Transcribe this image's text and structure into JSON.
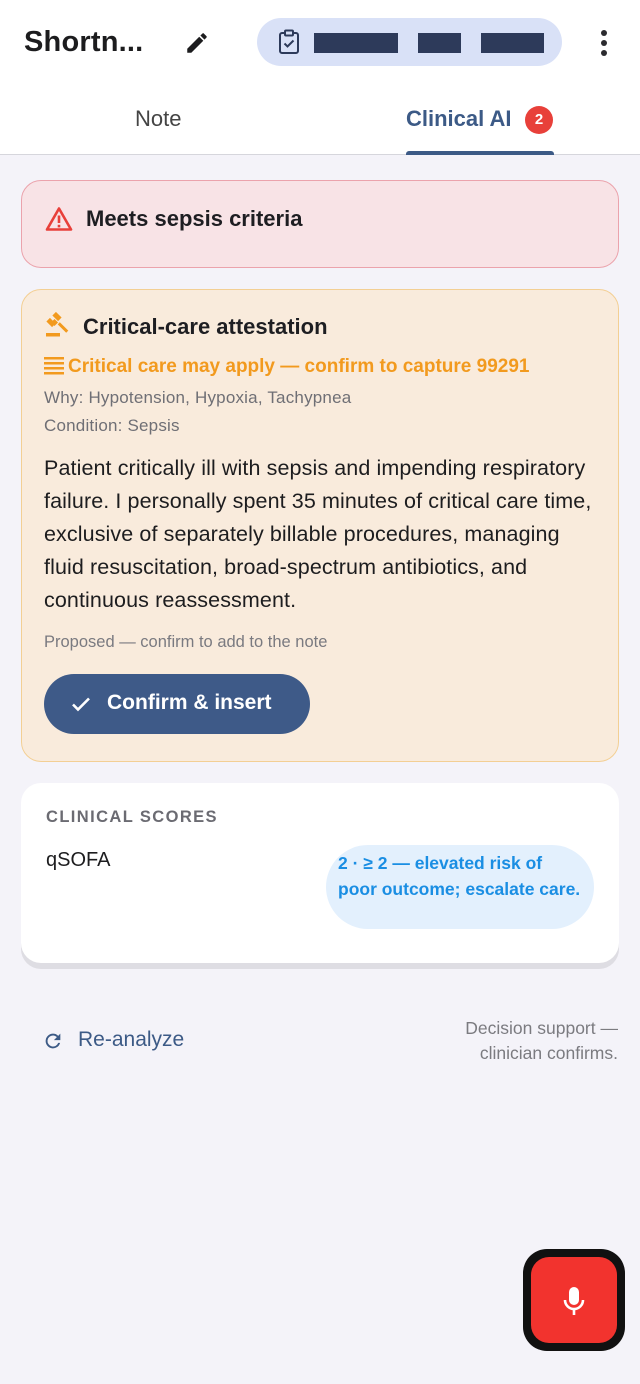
{
  "header": {
    "title": "Shortn...",
    "edit_icon": "pencil-icon",
    "patient_chip_icon": "clipboard-check-icon",
    "more_icon": "more-vertical-icon"
  },
  "tabs": [
    {
      "label": "Note",
      "active": false
    },
    {
      "label": "Clinical AI",
      "active": true,
      "badge": "2"
    }
  ],
  "alert": {
    "icon": "warning-triangle-icon",
    "text": "Meets sepsis criteria",
    "color": "#e8403a"
  },
  "attestation": {
    "icon": "gavel-icon",
    "title": "Critical-care attestation",
    "billing_icon": "billing-lines-icon",
    "billing_text": "Critical care may apply — confirm to capture 99291",
    "why": "Why: Hypotension, Hypoxia, Tachypnea",
    "condition": "Condition: Sepsis",
    "body": "Patient critically ill with sepsis and impending respiratory failure. I personally spent 35 minutes of critical care time, exclusive of separately billable procedures, managing fluid resuscitation, broad-spectrum antibiotics, and continuous reassessment.",
    "proposed_note": "Proposed — confirm to add to the note",
    "confirm_label": "Confirm & insert",
    "accent_color": "#f29a1e"
  },
  "scores": {
    "header": "CLINICAL SCORES",
    "items": [
      {
        "name": "qSOFA",
        "result": "2 · ≥ 2 — elevated risk of poor outcome; escalate care."
      }
    ]
  },
  "footer": {
    "reanalyze_icon": "refresh-icon",
    "reanalyze_label": "Re-analyze",
    "disclaimer_line1": "Decision support —",
    "disclaimer_line2": "clinician confirms."
  },
  "fab": {
    "icon": "microphone-icon",
    "color": "#f2332e"
  },
  "colors": {
    "primary": "#3e5a88",
    "background": "#f4f3f9"
  }
}
